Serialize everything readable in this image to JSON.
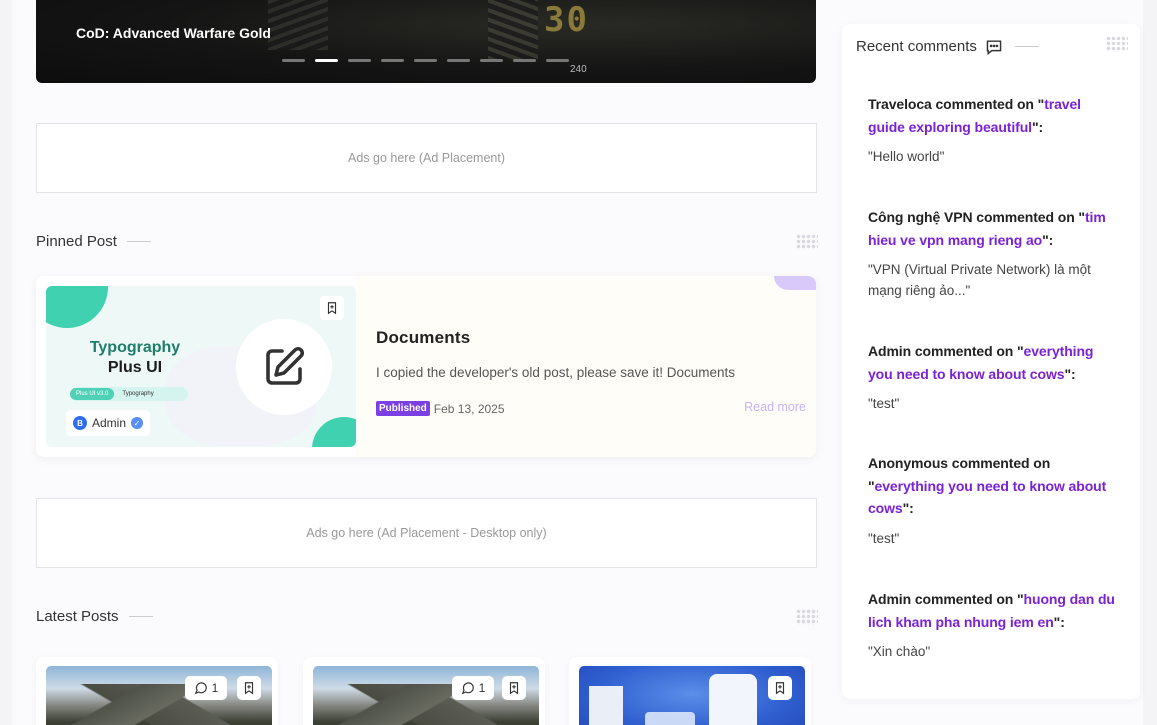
{
  "hero": {
    "title": "CoD: Advanced Warfare Gold",
    "overlay_number": "30",
    "overlay_small": "240",
    "slides_count": 9,
    "active_slide": 2
  },
  "ads": {
    "top": "Ads go here (Ad Placement)",
    "middle": "Ads go here (Ad Placement - Desktop only)"
  },
  "pinned": {
    "section_title": "Pinned Post",
    "thumb_title_line1": "Typography",
    "thumb_title_line2": "Plus UI",
    "thumb_pill_1": "Plus UI v3.0",
    "thumb_pill_2": "Typography",
    "author_initial": "B",
    "author": "Admin",
    "post_title": "Documents",
    "excerpt": "I copied the developer's old post, please save it! Documents",
    "badge": "Published",
    "date": "Feb 13, 2025",
    "read_more": "Read more"
  },
  "latest": {
    "section_title": "Latest Posts",
    "cards": [
      {
        "comments": "1"
      },
      {
        "comments": "1"
      },
      {}
    ]
  },
  "sidebar": {
    "title": "Recent comments",
    "comments": [
      {
        "author": "Traveloca",
        "verb": " commented on \"",
        "post": "travel guide exploring beautiful",
        "end": "\":",
        "text": "\"Hello world\""
      },
      {
        "author": "Công nghệ VPN",
        "verb": " commented on \"",
        "post": "tim hieu ve vpn mang rieng ao",
        "end": "\":",
        "text": "\"VPN (Virtual Private Network) là một mạng riêng ảo...\""
      },
      {
        "author": "Admin",
        "verb": " commented on \"",
        "post": "everything you need to know about cows",
        "end": "\":",
        "text": "\"test\""
      },
      {
        "author": "Anonymous",
        "verb": " commented on \"",
        "post": "everything you need to know about cows",
        "end": "\":",
        "text": "\"test\""
      },
      {
        "author": "Admin",
        "verb": " commented on \"",
        "post": "huong dan du lich kham pha nhung iem en",
        "end": "\":",
        "text": "\"Xin chào\""
      }
    ]
  }
}
